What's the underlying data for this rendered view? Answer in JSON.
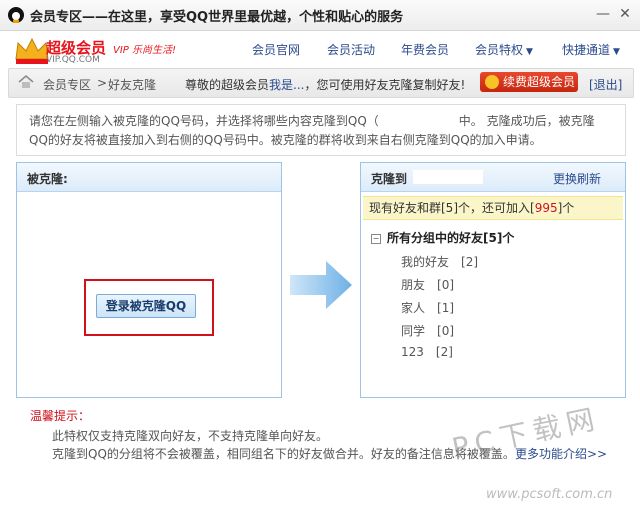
{
  "window": {
    "title": "会员专区——在这里，享受QQ世界里最优越，个性和贴心的服务",
    "minimize_label": "—",
    "close_label": "✕"
  },
  "header": {
    "logo_title": "超级会员",
    "logo_sub": "VIP.QQ.COM",
    "logo_tag": "VIP 乐尚生活!",
    "nav": [
      {
        "label": "会员官网"
      },
      {
        "label": "会员活动"
      },
      {
        "label": "年费会员"
      },
      {
        "label": "会员特权",
        "caret": "▼"
      },
      {
        "label": "快捷通道",
        "caret": "▼"
      }
    ]
  },
  "breadcrumb": {
    "home": "会员专区",
    "sep": ">",
    "current": "好友克隆",
    "welcome_prefix": "尊敬的超级会员",
    "welcome_name": "我是...",
    "welcome_suffix": "，您可使用好友克隆复制好友!",
    "renew_label": "续费超级会员",
    "logout_label": "[退出]"
  },
  "instruction": {
    "line1_a": "请您在左侧输入被克隆的QQ号码，并选择将哪些内容克隆到QQ（",
    "line1_b": "中。 克隆成功后，被克隆",
    "line2": "QQ的好友将被直接加入到右侧的QQ号码中。被克隆的群将收到来自右侧克隆到QQ的加入申请。"
  },
  "left_panel": {
    "heading": "被克隆:",
    "login_button": "登录被克隆QQ"
  },
  "right_panel": {
    "heading": "克隆到",
    "refresh_label": "更换刷新",
    "quota_prefix": "现有好友和群[5]个，还可加入[",
    "quota_value": "995",
    "quota_suffix": "]个",
    "group_toggle": "−",
    "group_root": "所有分组中的好友[5]个",
    "groups": [
      {
        "name": "我的好友",
        "count": "[2]"
      },
      {
        "name": "朋友",
        "count": "[0]"
      },
      {
        "name": "家人",
        "count": "[1]"
      },
      {
        "name": "同学",
        "count": "[0]"
      },
      {
        "name": "123",
        "count": "[2]"
      }
    ]
  },
  "tips": {
    "title": "温馨提示：",
    "line1": "此特权仅支持克隆双向好友，不支持克隆单向好友。",
    "line2": "克隆到QQ的分组将不会被覆盖，相同组名下的好友做合并。好友的备注信息将被覆盖。",
    "more_link": "更多功能介绍>>"
  },
  "watermark": {
    "big": "PC下载网",
    "url": "www.pcsoft.com.cn"
  },
  "colors": {
    "accent_blue": "#2a4b8d",
    "brand_red": "#e8141b",
    "panel_border": "#9dc4e6",
    "highlight_frame": "#d0101b",
    "quota_bg": "#fbf6c9"
  },
  "icons": {
    "app": "qq-penguin-icon",
    "home": "home-icon",
    "crown": "crown-icon",
    "arrow": "right-arrow-icon"
  }
}
